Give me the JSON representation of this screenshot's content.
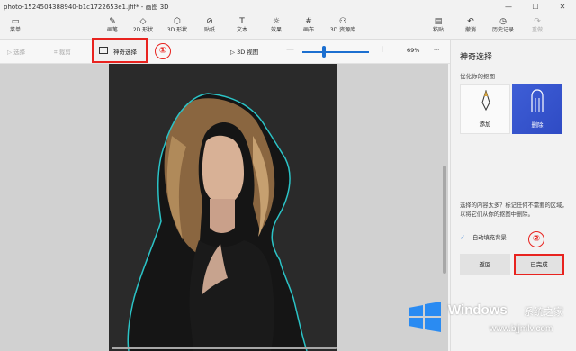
{
  "window": {
    "title": "photo-1524504388940-b1c1722653e1.jfif* - 画图 3D",
    "minimize": "—",
    "maximize": "☐",
    "close": "✕"
  },
  "ribbon": {
    "menu": "菜单",
    "brush": "画笔",
    "shapes2d": "2D 形状",
    "shapes3d": "3D 形状",
    "stickers": "贴纸",
    "text": "文本",
    "effects": "效果",
    "canvas": "画布",
    "library3d": "3D 资源库",
    "paste": "粘贴",
    "undo": "撤消",
    "history": "历史记录",
    "redo": "重做"
  },
  "toolbar": {
    "select": "选择",
    "crop": "裁剪",
    "magic_select": "神奇选择",
    "view3d": "3D 视图",
    "zoom_out": "—",
    "zoom_in": "+",
    "zoom": "69%",
    "more": "···",
    "zoom_level": 0.35
  },
  "annotations": {
    "marker1": "①",
    "marker2": "②"
  },
  "panel": {
    "title": "神奇选择",
    "subtitle": "优化你的抠图",
    "add_label": "添加",
    "remove_label": "删除",
    "description": "选择的内容太多？标记任何不需要的区域，以将它们从你的抠图中删除。",
    "autofill_label": "自动填充背景",
    "autofill_checked": true,
    "back_button": "返回",
    "done_button": "已完成"
  },
  "watermark": {
    "brand": "Windows",
    "cn": "系统之家",
    "url": "www.bjjmlv.com"
  },
  "colors": {
    "accent": "#1c6fd0",
    "highlight": "#e8231f",
    "selection_outline": "#2bc3c6"
  }
}
